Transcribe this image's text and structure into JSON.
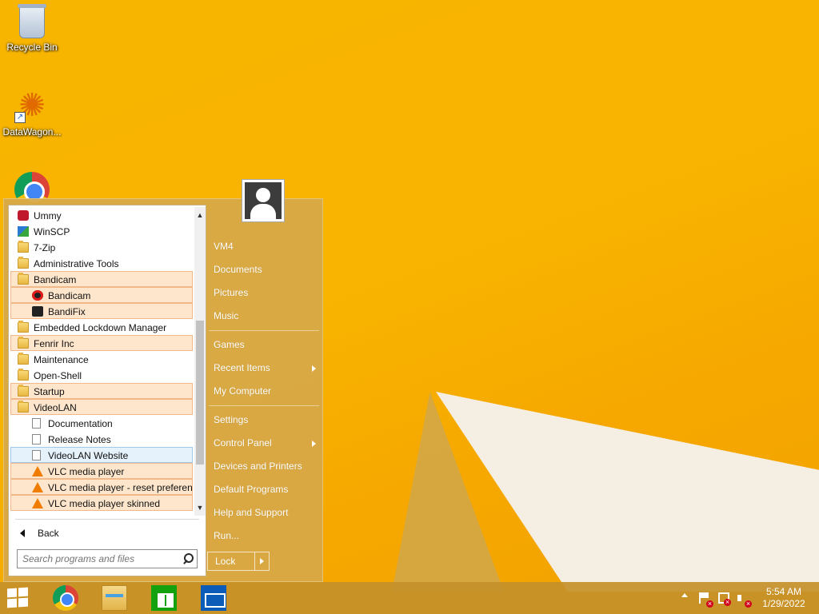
{
  "desktop": {
    "icons": [
      {
        "label": "Recycle Bin"
      },
      {
        "label": "DataWagon..."
      },
      {
        "label": ""
      }
    ]
  },
  "start_menu": {
    "programs": [
      {
        "label": "Ummy",
        "icon": "ummy-icon",
        "indent": false,
        "highlight": false
      },
      {
        "label": "WinSCP",
        "icon": "winscp-icon",
        "indent": false,
        "highlight": false
      },
      {
        "label": "7-Zip",
        "icon": "folder-icon",
        "indent": false,
        "highlight": false
      },
      {
        "label": "Administrative Tools",
        "icon": "folder-icon",
        "indent": false,
        "highlight": false
      },
      {
        "label": "Bandicam",
        "icon": "folder-icon",
        "indent": false,
        "highlight": true
      },
      {
        "label": "Bandicam",
        "icon": "bandicam-icon",
        "indent": true,
        "highlight": true
      },
      {
        "label": "BandiFix",
        "icon": "bandifix-icon",
        "indent": true,
        "highlight": true
      },
      {
        "label": "Embedded Lockdown Manager",
        "icon": "folder-icon",
        "indent": false,
        "highlight": false
      },
      {
        "label": "Fenrir Inc",
        "icon": "folder-icon",
        "indent": false,
        "highlight": true
      },
      {
        "label": "Maintenance",
        "icon": "folder-icon",
        "indent": false,
        "highlight": false
      },
      {
        "label": "Open-Shell",
        "icon": "folder-icon",
        "indent": false,
        "highlight": false
      },
      {
        "label": "Startup",
        "icon": "folder-icon",
        "indent": false,
        "highlight": true
      },
      {
        "label": "VideoLAN",
        "icon": "folder-icon",
        "indent": false,
        "highlight": true
      },
      {
        "label": "Documentation",
        "icon": "document-icon",
        "indent": true,
        "highlight": false
      },
      {
        "label": "Release Notes",
        "icon": "document-icon",
        "indent": true,
        "highlight": false
      },
      {
        "label": "VideoLAN Website",
        "icon": "document-icon",
        "indent": true,
        "highlight": false,
        "selected": true
      },
      {
        "label": "VLC media player",
        "icon": "vlc-icon",
        "indent": true,
        "highlight": true
      },
      {
        "label": "VLC media player - reset preferences and cache files",
        "icon": "vlc-icon",
        "indent": true,
        "highlight": true
      },
      {
        "label": "VLC media player skinned",
        "icon": "vlc-icon",
        "indent": true,
        "highlight": true
      }
    ],
    "back_label": "Back",
    "search_placeholder": "Search programs and files",
    "right_groups": [
      [
        "VM4",
        "Documents",
        "Pictures",
        "Music"
      ],
      [
        "Games",
        "Recent Items",
        "My Computer"
      ],
      [
        "Settings",
        "Control Panel",
        "Devices and Printers",
        "Default Programs",
        "Help and Support",
        "Run..."
      ]
    ],
    "submenu_items": [
      "Recent Items",
      "Control Panel"
    ],
    "lock_label": "Lock"
  },
  "taskbar": {
    "pinned": [
      "start-button",
      "chrome",
      "file-explorer",
      "store",
      "mail"
    ],
    "clock_time": "5:54 AM",
    "clock_date": "1/29/2022"
  },
  "colors": {
    "accent": "#d6a848",
    "highlight": "#fde6cc",
    "selected": "#e5f1fb"
  }
}
